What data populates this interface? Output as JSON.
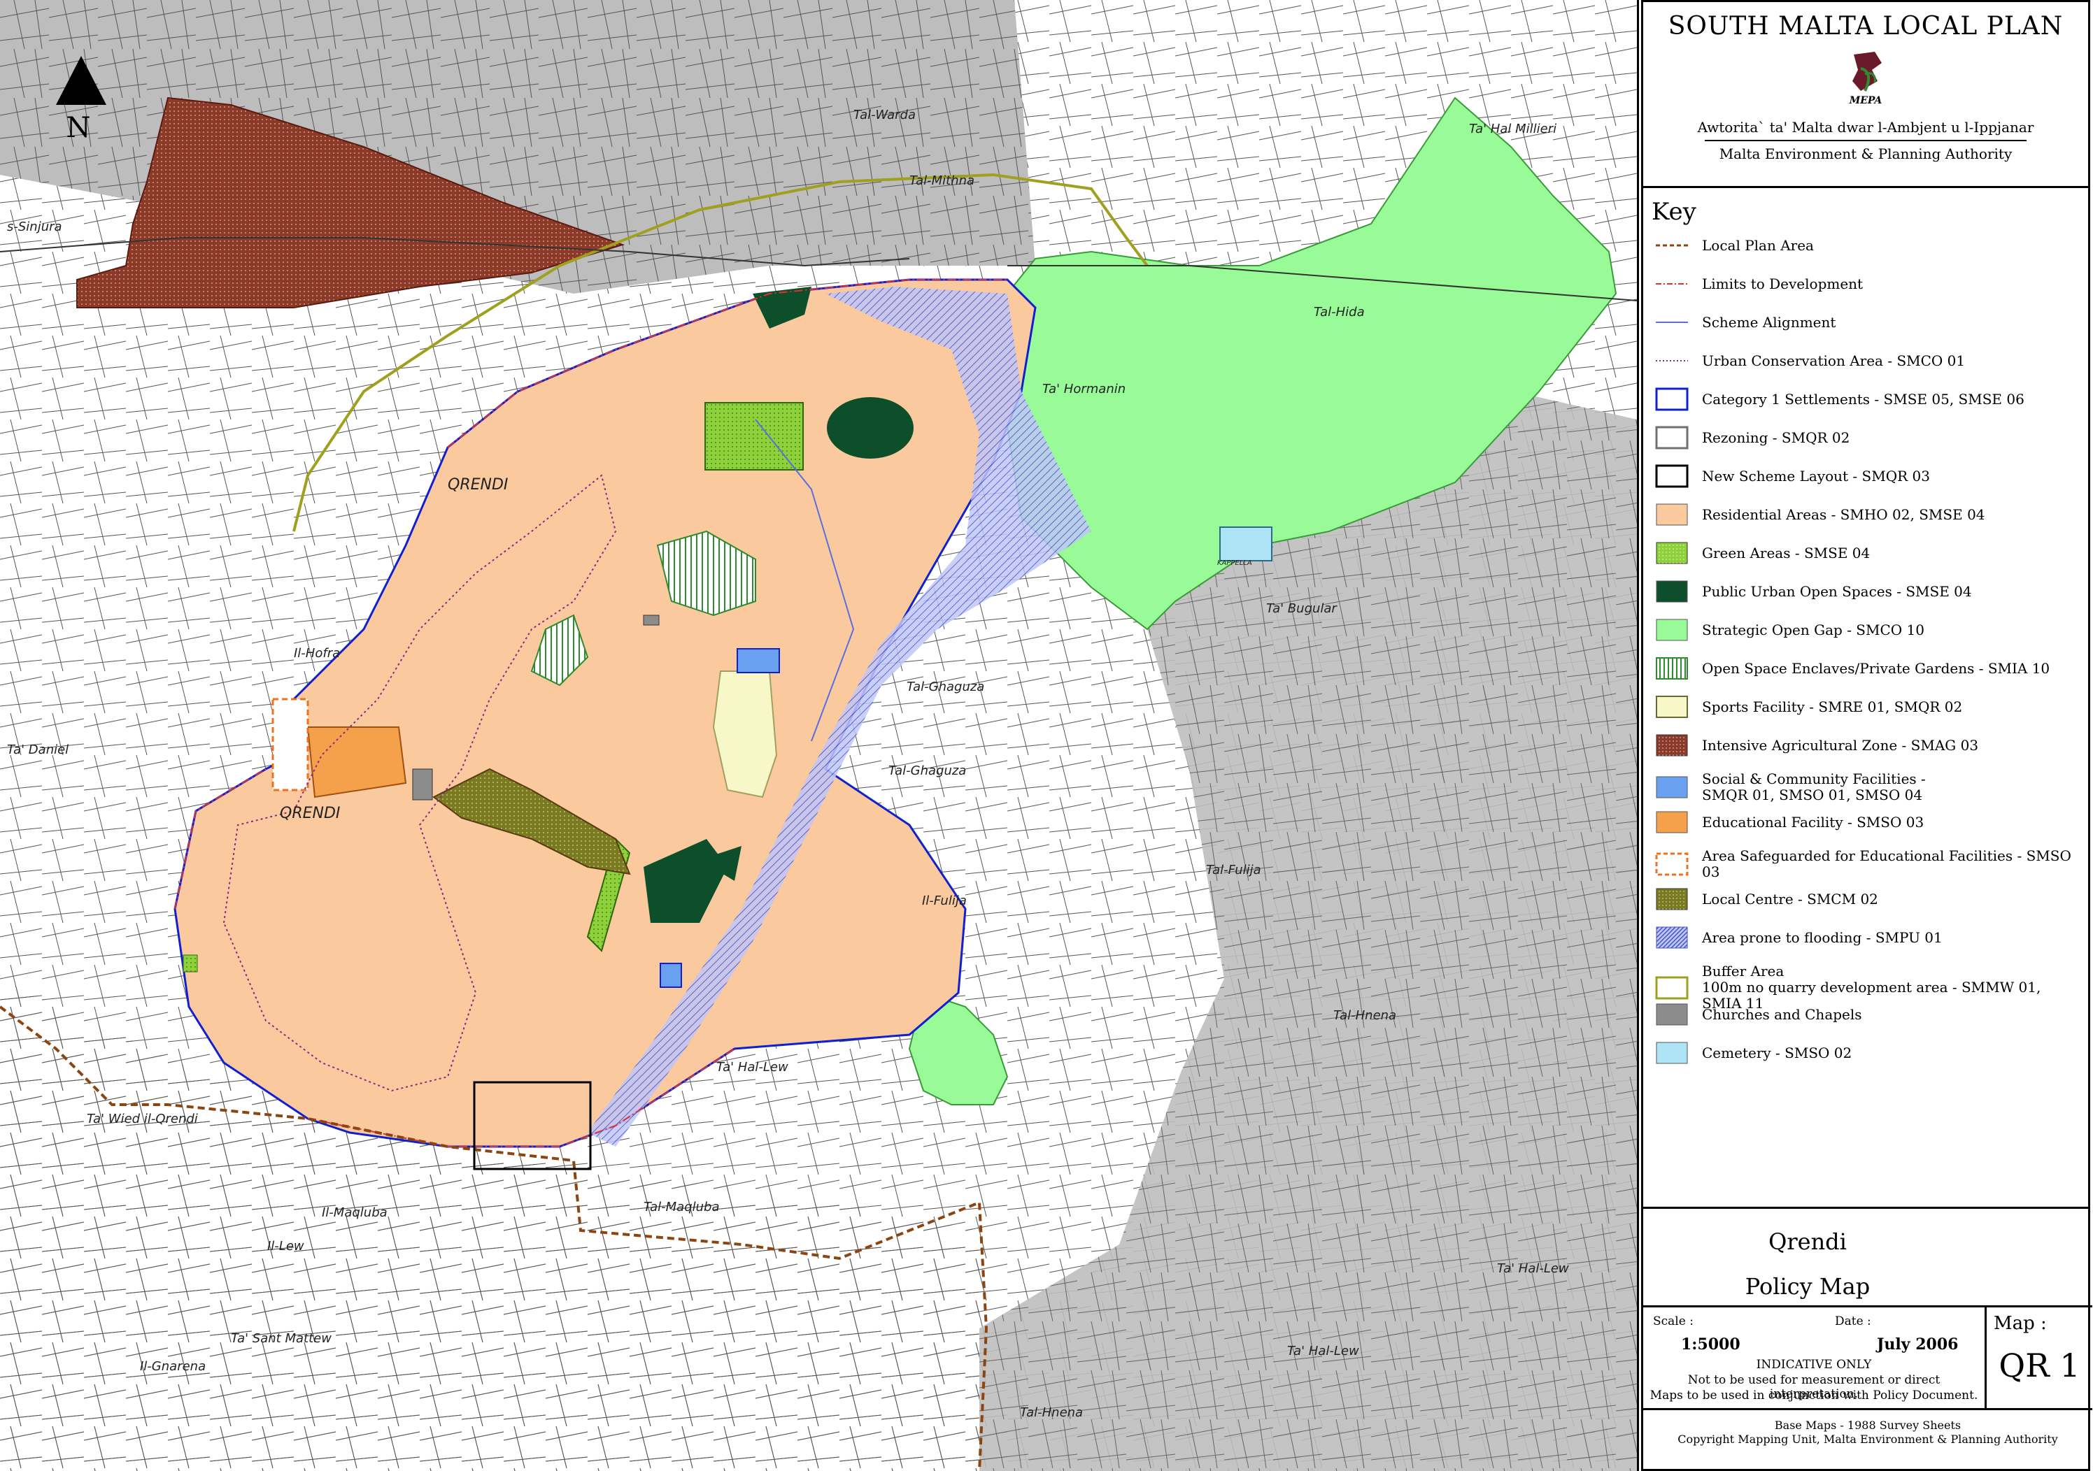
{
  "map_labels": {
    "north": "N",
    "locality_1": "QRENDI",
    "locality_2": "QRENDI",
    "tal_warda": "Tal-Warda",
    "tal_mithna": "Tal-Mithna",
    "ta_hal_millieri": "Ta' Hal Millieri",
    "s_sinjura": "s-Sinjura",
    "tal_hida": "Tal-Hida",
    "ta_hormanin": "Ta' Hormanin",
    "ta_bugular": "Ta' Bugular",
    "il_hofra": "Il-Hofra",
    "ta_daniel": "Ta' Daniel",
    "tal_ghaguza_1": "Tal-Ghaguza",
    "tal_ghaguza_2": "Tal-Ghaguza",
    "il_fulija": "Il-Fulija",
    "tal_fulija": "Tal-Fulija",
    "ta_hal_lew": "Ta' Hal-Lew",
    "ta_wied_il_qrendi": "Ta' Wied il-Qrendi",
    "il_maqluba": "Il-Maqluba",
    "tal_maqluba": "Tal-Maqluba",
    "il_lew": "Il-Lew",
    "tal_hnena": "Tal-Hnena",
    "ta_sant_mattew": "Ta' Sant Mattew",
    "il_gnarena": "Il-Gnarena",
    "ta_hal_lew_2": "Ta' Hal-Lew",
    "ta_hal_lew_3": "Ta' Hal-Lew",
    "tal_hnena_2": "Tal-Hnena",
    "kappella": "KAPPELLA"
  },
  "panel": {
    "plan_title": "SOUTH MALTA LOCAL PLAN",
    "logo_text": "MEPA",
    "authority_mt": "Awtorita` ta' Malta dwar l-Ambjent u l-Ippjanar",
    "authority_en": "Malta Environment & Planning Authority",
    "key_heading": "Key",
    "map_name": "Qrendi",
    "map_type": "Policy Map",
    "scale_label": "Scale :",
    "scale_value": "1:5000",
    "date_label": "Date :",
    "date_value": "July 2006",
    "map_label": "Map :",
    "map_number": "QR 1",
    "indicative": "INDICATIVE ONLY",
    "disclaimer_1": "Not to be used for measurement or direct interpretation.",
    "disclaimer_2": "Maps to be used in conjunction with Policy Document.",
    "base_maps": "Base Maps - 1988 Survey Sheets",
    "copyright": "Copyright Mapping Unit, Malta Environment & Planning Authority"
  },
  "legend": [
    {
      "label": "Local Plan Area",
      "symbol": "dash-line",
      "color": "#8b4513"
    },
    {
      "label": "Limits to Development",
      "symbol": "dashdot-line",
      "color": "#e03030"
    },
    {
      "label": "Scheme Alignment",
      "symbol": "solid-line",
      "color": "#5a6ee0"
    },
    {
      "label": "Urban Conservation Area - SMCO 01",
      "symbol": "dot-line",
      "color": "#8a2a8a"
    },
    {
      "label": "Category 1 Settlements - SMSE 05, SMSE 06",
      "symbol": "outline",
      "color": "#1020d0"
    },
    {
      "label": "Rezoning - SMQR 02",
      "symbol": "outline",
      "color": "#707070"
    },
    {
      "label": "New Scheme Layout - SMQR 03",
      "symbol": "outline",
      "color": "#000000"
    },
    {
      "label": "Residential Areas - SMHO 02, SMSE 04",
      "symbol": "fill",
      "color": "#fbc99e"
    },
    {
      "label": "Green Areas - SMSE 04",
      "symbol": "fill-dots",
      "color": "#8ed13a"
    },
    {
      "label": "Public Urban Open Spaces - SMSE 04",
      "symbol": "fill",
      "color": "#0d4f2a"
    },
    {
      "label": "Strategic Open Gap - SMCO 10",
      "symbol": "fill",
      "color": "#98fb98"
    },
    {
      "label": "Open Space Enclaves/Private Gardens - SMIA 10",
      "symbol": "fill-vlines",
      "color": "#2e8b2e"
    },
    {
      "label": "Sports Facility - SMRE 01, SMQR 02",
      "symbol": "fill-outline",
      "color": "#f7f7c8"
    },
    {
      "label": "Intensive Agricultural Zone - SMAG 03",
      "symbol": "fill-dots",
      "color": "#8b3a2a"
    },
    {
      "label": "Social & Community Facilities -",
      "label_2": "SMQR 01, SMSO 01, SMSO 04",
      "symbol": "fill",
      "color": "#6aa0f0"
    },
    {
      "label": "Educational Facility - SMSO 03",
      "symbol": "fill",
      "color": "#f5a04a"
    },
    {
      "label": "Area Safeguarded for Educational Facilities - SMSO 03",
      "symbol": "dash-outline",
      "color": "#f07020"
    },
    {
      "label": "Local Centre - SMCM 02",
      "symbol": "fill-dots",
      "color": "#7a7a20"
    },
    {
      "label": "Area prone to flooding - SMPU 01",
      "symbol": "fill-hatch",
      "color": "#4050d0"
    },
    {
      "label": "Buffer Area",
      "label_2": "100m no quarry development area - SMMW 01, SMIA 11",
      "symbol": "outline",
      "color": "#a0a020"
    },
    {
      "label": "Churches and Chapels",
      "symbol": "fill",
      "color": "#8c8c8c"
    },
    {
      "label": "Cemetery - SMSO 02",
      "symbol": "fill",
      "color": "#aee4f5"
    }
  ]
}
